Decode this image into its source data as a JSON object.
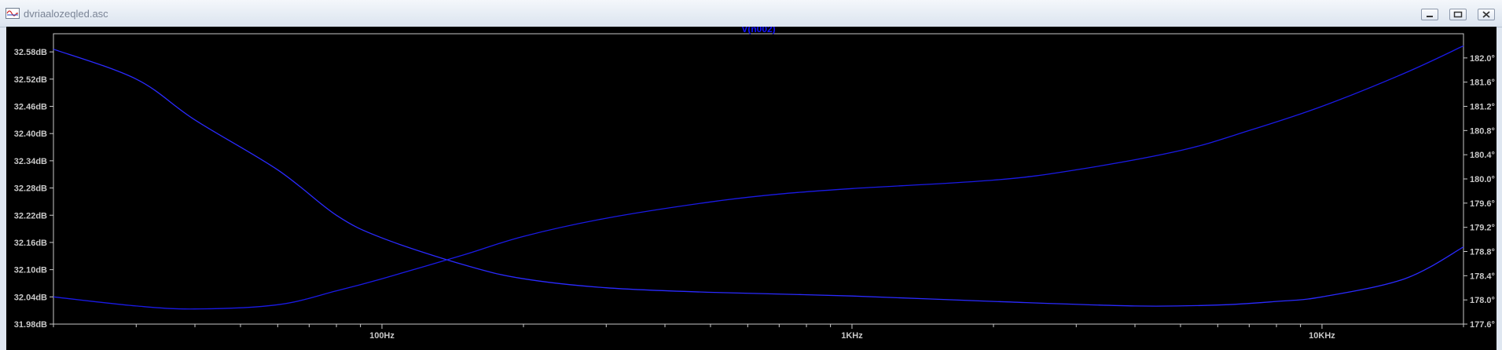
{
  "window": {
    "title": "dvriaalozeqled.asc"
  },
  "chart_data": {
    "type": "line",
    "title": "V(n002)",
    "x_scale": "log",
    "xlim": [
      20,
      20000
    ],
    "x_ticks": [
      {
        "value": 100,
        "label": "100Hz"
      },
      {
        "value": 1000,
        "label": "1KHz"
      },
      {
        "value": 10000,
        "label": "10KHz"
      }
    ],
    "left_axis": {
      "unit": "dB",
      "ylim": [
        31.98,
        32.62
      ],
      "ticks": [
        {
          "value": 32.58,
          "label": "32.58dB"
        },
        {
          "value": 32.52,
          "label": "32.52dB"
        },
        {
          "value": 32.46,
          "label": "32.46dB"
        },
        {
          "value": 32.4,
          "label": "32.40dB"
        },
        {
          "value": 32.34,
          "label": "32.34dB"
        },
        {
          "value": 32.28,
          "label": "32.28dB"
        },
        {
          "value": 32.22,
          "label": "32.22dB"
        },
        {
          "value": 32.16,
          "label": "32.16dB"
        },
        {
          "value": 32.1,
          "label": "32.10dB"
        },
        {
          "value": 32.04,
          "label": "32.04dB"
        },
        {
          "value": 31.98,
          "label": "31.98dB"
        }
      ]
    },
    "right_axis": {
      "unit": "°",
      "ylim": [
        177.6,
        182.4
      ],
      "ticks": [
        {
          "value": 182.0,
          "label": "182.0°"
        },
        {
          "value": 181.6,
          "label": "181.6°"
        },
        {
          "value": 181.2,
          "label": "181.2°"
        },
        {
          "value": 180.8,
          "label": "180.8°"
        },
        {
          "value": 180.4,
          "label": "180.4°"
        },
        {
          "value": 180.0,
          "label": "180.0°"
        },
        {
          "value": 179.6,
          "label": "179.6°"
        },
        {
          "value": 179.2,
          "label": "179.2°"
        },
        {
          "value": 178.8,
          "label": "178.8°"
        },
        {
          "value": 178.4,
          "label": "178.4°"
        },
        {
          "value": 178.0,
          "label": "178.0°"
        },
        {
          "value": 177.6,
          "label": "177.6°"
        }
      ]
    },
    "series": [
      {
        "axis": "left",
        "color": "#2a2aff",
        "points": [
          [
            20,
            32.586
          ],
          [
            30,
            32.52
          ],
          [
            40,
            32.43
          ],
          [
            60,
            32.32
          ],
          [
            80,
            32.22
          ],
          [
            100,
            32.17
          ],
          [
            150,
            32.11
          ],
          [
            200,
            32.08
          ],
          [
            300,
            32.06
          ],
          [
            500,
            32.05
          ],
          [
            1000,
            32.042
          ],
          [
            2000,
            32.03
          ],
          [
            4000,
            32.02
          ],
          [
            6000,
            32.022
          ],
          [
            8000,
            32.03
          ],
          [
            10000,
            32.04
          ],
          [
            15000,
            32.08
          ],
          [
            20000,
            32.15
          ]
        ]
      },
      {
        "axis": "right",
        "color": "#1a1ae6",
        "points": [
          [
            20,
            178.05
          ],
          [
            30,
            177.9
          ],
          [
            40,
            177.85
          ],
          [
            60,
            177.92
          ],
          [
            80,
            178.15
          ],
          [
            100,
            178.35
          ],
          [
            150,
            178.75
          ],
          [
            200,
            179.05
          ],
          [
            300,
            179.35
          ],
          [
            500,
            179.62
          ],
          [
            700,
            179.75
          ],
          [
            1000,
            179.84
          ],
          [
            2000,
            179.98
          ],
          [
            3000,
            180.15
          ],
          [
            5000,
            180.47
          ],
          [
            7000,
            180.8
          ],
          [
            10000,
            181.2
          ],
          [
            15000,
            181.75
          ],
          [
            20000,
            182.2
          ]
        ]
      }
    ],
    "grid": false,
    "legend": false
  },
  "theme": {
    "plot_bg": "#000000",
    "frame": "#c8c8c8",
    "text": "#c8c8c8"
  }
}
